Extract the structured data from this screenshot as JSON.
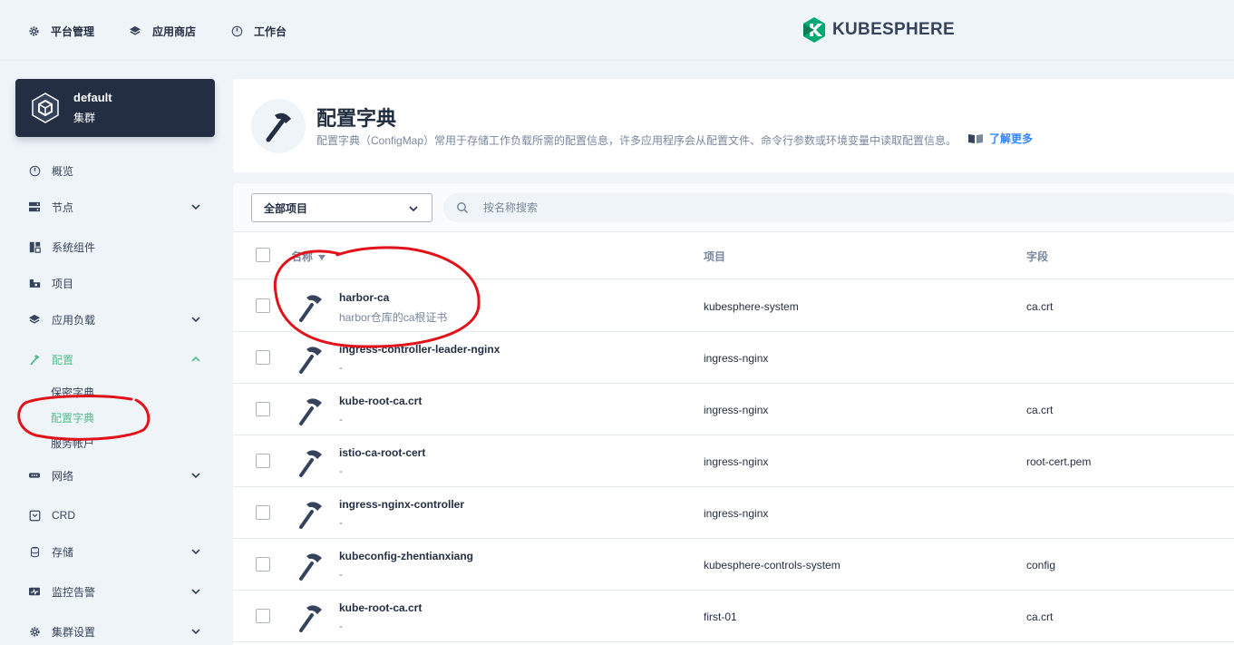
{
  "topnav": {
    "items": [
      {
        "label": "平台管理",
        "icon": "gear-icon"
      },
      {
        "label": "应用商店",
        "icon": "layers-icon"
      },
      {
        "label": "工作台",
        "icon": "dashboard-icon"
      }
    ],
    "logo_text": "KUBESPHERE"
  },
  "cluster": {
    "name": "default",
    "type": "集群"
  },
  "sidebar": {
    "items": [
      {
        "label": "概览",
        "icon": "dashboard-icon"
      },
      {
        "label": "节点",
        "icon": "server-icon"
      },
      {
        "label": "系统组件",
        "icon": "components-icon"
      },
      {
        "label": "项目",
        "icon": "project-icon"
      },
      {
        "label": "应用负载",
        "icon": "layers-icon"
      },
      {
        "label": "配置",
        "icon": "hammer-icon"
      },
      {
        "label": "网络",
        "icon": "network-icon"
      },
      {
        "label": "CRD",
        "icon": "crd-icon"
      },
      {
        "label": "存储",
        "icon": "database-icon"
      },
      {
        "label": "监控告警",
        "icon": "monitor-icon"
      },
      {
        "label": "集群设置",
        "icon": "gear-icon"
      }
    ],
    "config_sub": [
      "保密字典",
      "配置字典",
      "服务帐户"
    ]
  },
  "header": {
    "title": "配置字典",
    "description": "配置字典（ConfigMap）常用于存储工作负载所需的配置信息，许多应用程序会从配置文件、命令行参数或环境变量中读取配置信息。",
    "learn_more": "了解更多"
  },
  "toolbar": {
    "project_select": "全部项目",
    "search_placeholder": "按名称搜索"
  },
  "table": {
    "columns": [
      "名称",
      "项目",
      "字段"
    ],
    "rows": [
      {
        "name": "harbor-ca",
        "desc": "harbor仓库的ca根证书",
        "project": "kubesphere-system",
        "field": "ca.crt"
      },
      {
        "name": "ingress-controller-leader-nginx",
        "desc": "-",
        "project": "ingress-nginx",
        "field": ""
      },
      {
        "name": "kube-root-ca.crt",
        "desc": "-",
        "project": "ingress-nginx",
        "field": "ca.crt"
      },
      {
        "name": "istio-ca-root-cert",
        "desc": "-",
        "project": "ingress-nginx",
        "field": "root-cert.pem"
      },
      {
        "name": "ingress-nginx-controller",
        "desc": "-",
        "project": "ingress-nginx",
        "field": ""
      },
      {
        "name": "kubeconfig-zhentianxiang",
        "desc": "-",
        "project": "kubesphere-controls-system",
        "field": "config"
      },
      {
        "name": "kube-root-ca.crt",
        "desc": "-",
        "project": "first-01",
        "field": "ca.crt"
      }
    ]
  },
  "colors": {
    "accent": "#55bc8a",
    "link": "#3385ff",
    "dark": "#242e42",
    "annotation": "#e0131b"
  }
}
